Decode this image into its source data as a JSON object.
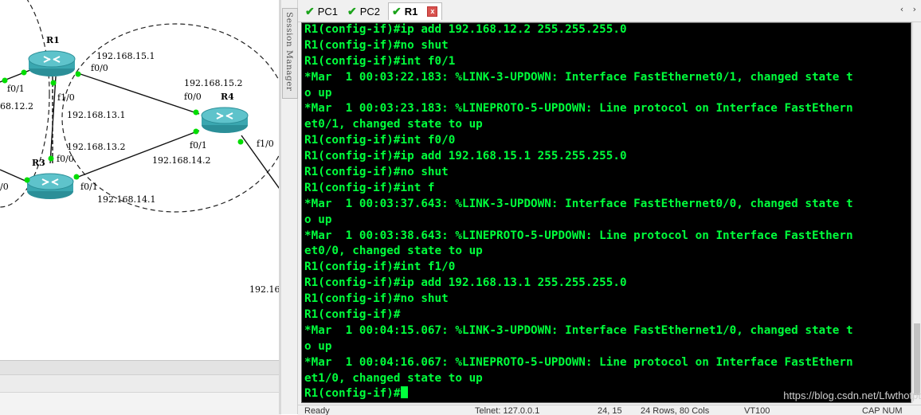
{
  "session_manager": {
    "label": "Session Manager"
  },
  "tabs": [
    {
      "label": "PC1",
      "active": false
    },
    {
      "label": "PC2",
      "active": false
    },
    {
      "label": "R1",
      "active": true
    }
  ],
  "tab_close_symbol": "x",
  "tab_scroll": {
    "left": "‹",
    "right": "›"
  },
  "topology": {
    "routers": {
      "r1": "R1",
      "r3": "R3",
      "r4": "R4"
    },
    "labels": {
      "r1_ip_15": "192.168.15.1",
      "r1_f00": "f0/0",
      "r1_f01": "f0/1",
      "r1_f10": "f1/0",
      "ip_12_partial": "68.12.2",
      "ip_13_1": "192.168.13.1",
      "ip_15_2": "192.168.15.2",
      "r4_f00": "f0/0",
      "r4_f01": "f0/1",
      "r4_f10": "f1/0",
      "ip_13_2": "192.168.13.2",
      "r3_f00": "f0/0",
      "ip_14_2": "192.168.14.2",
      "r3_f01": "f0/1",
      "r3_partial": "/0",
      "ip_14_1": "192.168.14.1",
      "ip_partial_bottom": "192.16"
    }
  },
  "terminal": {
    "lines": [
      "R1(config-if)#ip add 192.168.12.2 255.255.255.0",
      "R1(config-if)#no shut",
      "R1(config-if)#int f0/1",
      "*Mar  1 00:03:22.183: %LINK-3-UPDOWN: Interface FastEthernet0/1, changed state t",
      "o up",
      "*Mar  1 00:03:23.183: %LINEPROTO-5-UPDOWN: Line protocol on Interface FastEthern",
      "et0/1, changed state to up",
      "R1(config-if)#int f0/0",
      "R1(config-if)#ip add 192.168.15.1 255.255.255.0",
      "R1(config-if)#no shut",
      "R1(config-if)#int f",
      "*Mar  1 00:03:37.643: %LINK-3-UPDOWN: Interface FastEthernet0/0, changed state t",
      "o up",
      "*Mar  1 00:03:38.643: %LINEPROTO-5-UPDOWN: Line protocol on Interface FastEthern",
      "et0/0, changed state to up",
      "R1(config-if)#int f1/0",
      "R1(config-if)#ip add 192.168.13.1 255.255.255.0",
      "R1(config-if)#no shut",
      "R1(config-if)#",
      "*Mar  1 00:04:15.067: %LINK-3-UPDOWN: Interface FastEthernet1/0, changed state t",
      "o up",
      "*Mar  1 00:04:16.067: %LINEPROTO-5-UPDOWN: Line protocol on Interface FastEthern",
      "et1/0, changed state to up",
      "R1(config-if)#"
    ],
    "colors": {
      "background": "#000000",
      "text": "#00ff3c"
    }
  },
  "watermark": "https://blog.csdn.net/Lfwthotpt",
  "status_bar": {
    "ready": "Ready",
    "protocol": "Telnet: 127.0.0.1",
    "position": "24, 15",
    "size": "24 Rows, 80 Cols",
    "terminal_type": "VT100",
    "caps": "CAP NUM"
  },
  "colors": {
    "accent_check": "#1aa31a",
    "port_dot": "#00dd00",
    "router_body": "#3aa7b0"
  }
}
